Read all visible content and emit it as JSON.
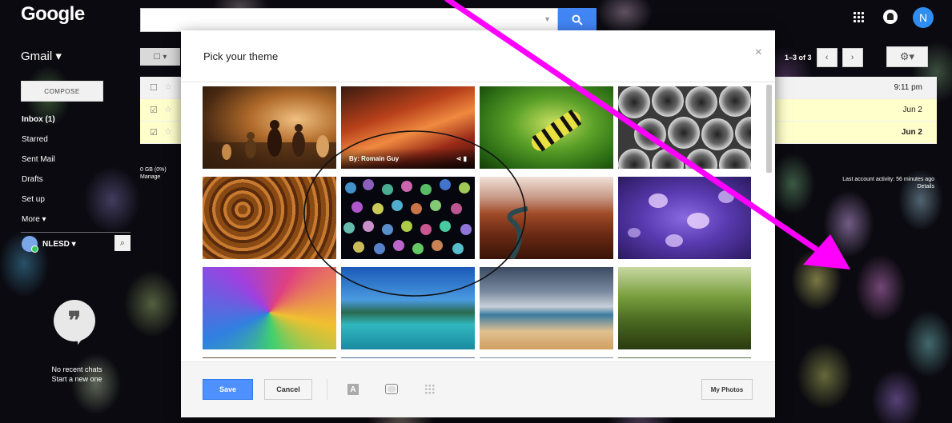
{
  "header": {
    "logo": "Google",
    "search_value": "",
    "avatar_letter": "N"
  },
  "sidebar": {
    "app_label": "Gmail ▾",
    "compose_label": "COMPOSE",
    "items": [
      {
        "label": "Inbox (1)",
        "bold": true
      },
      {
        "label": "Starred",
        "bold": false
      },
      {
        "label": "Sent Mail",
        "bold": false
      },
      {
        "label": "Drafts",
        "bold": false
      },
      {
        "label": "Set up",
        "bold": false
      },
      {
        "label": "More ▾",
        "bold": false
      }
    ],
    "account_name": "NLESD ▾",
    "chats_line1": "No recent chats",
    "chats_line2": "Start a new one"
  },
  "mail": {
    "pager_count": "1–3 of 3",
    "rows": [
      {
        "date": "9:11 pm"
      },
      {
        "date": "Jun 2"
      },
      {
        "date": "Jun 2"
      }
    ],
    "storage_line1": "0 GB (0%)",
    "storage_line2": "Manage",
    "activity_line1": "Last account activity: 56 minutes ago",
    "activity_line2": "Details"
  },
  "modal": {
    "title": "Pick your theme",
    "close": "×",
    "credit_text": "By: Romain Guy",
    "save_label": "Save",
    "cancel_label": "Cancel",
    "text_icon_letter": "A",
    "my_photos_label": "My Photos"
  },
  "colors": {
    "accent_blue": "#4285f4",
    "annotation_magenta": "#ff00ff",
    "selected_row": "#ffffcc"
  }
}
